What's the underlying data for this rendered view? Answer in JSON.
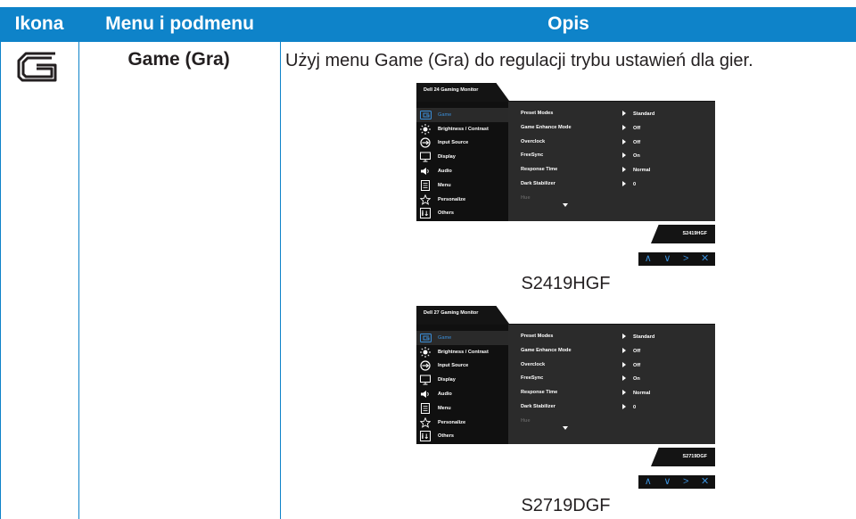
{
  "table": {
    "headers": {
      "icon": "Ikona",
      "menu": "Menu i podmenu",
      "desc": "Opis"
    },
    "row": {
      "menu_label": "Game (Gra)",
      "description": "Użyj menu Game (Gra) do regulacji trybu ustawień dla gier."
    }
  },
  "osd_1": {
    "title": "Dell 24 Gaming Monitor",
    "model": "S2419HGF",
    "caption": "S2419HGF"
  },
  "osd_2": {
    "title": "Dell 27 Gaming Monitor",
    "model": "S2719DGF",
    "caption": "S2719DGF"
  },
  "osd_menu": [
    {
      "label": "Game",
      "icon": "game-icon"
    },
    {
      "label": "Brightness / Contrast",
      "icon": "brightness-icon"
    },
    {
      "label": "Input Source",
      "icon": "input-source-icon"
    },
    {
      "label": "Display",
      "icon": "display-icon"
    },
    {
      "label": "Audio",
      "icon": "speaker-icon"
    },
    {
      "label": "Menu",
      "icon": "menu-icon"
    },
    {
      "label": "Personalize",
      "icon": "star-icon"
    },
    {
      "label": "Others",
      "icon": "others-icon"
    }
  ],
  "osd_settings": [
    {
      "label": "Preset Modes",
      "value": "Standard"
    },
    {
      "label": "Game Enhance Mode",
      "value": "Off"
    },
    {
      "label": "Overclock",
      "value": "Off"
    },
    {
      "label": "FreeSync",
      "value": "On"
    },
    {
      "label": "Response Time",
      "value": "Normal"
    },
    {
      "label": "Dark Stabilizer",
      "value": "0"
    },
    {
      "label": "Hue",
      "value": ""
    }
  ],
  "nav_buttons": [
    "∧",
    "∨",
    ">",
    "✕"
  ],
  "colors": {
    "header": "#0e83c9",
    "osd_highlight": "#3b8fd9"
  }
}
